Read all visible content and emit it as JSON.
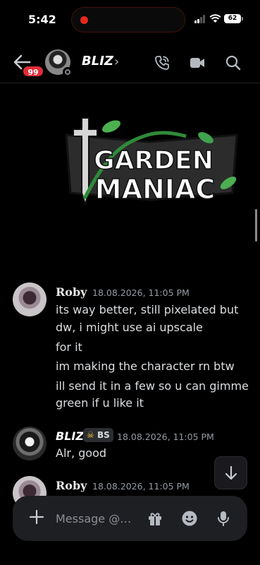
{
  "status_bar": {
    "time": "5:42",
    "battery": "62"
  },
  "header": {
    "badge_count": "99",
    "title": "BLIZ"
  },
  "banner": {
    "logo_line1": "GARDEN",
    "logo_line2": "MANIAC"
  },
  "messages": [
    {
      "author": "Roby",
      "timestamp": "18.08.2026, 11:05 PM",
      "lines": [
        "its way better, still pixelated but",
        "dw, i might use ai upscale",
        "for it",
        "im making the character rn btw",
        "ill send it in a few so u can gimme",
        "green if u like it"
      ]
    },
    {
      "author": "BLIZ",
      "tag": "BS",
      "timestamp": "18.08.2026, 11:05 PM",
      "lines": [
        "Alr, good"
      ]
    },
    {
      "author": "Roby",
      "timestamp": "18.08.2026, 11:05 PM",
      "lines": []
    }
  ],
  "composer": {
    "placeholder": "Message @…"
  },
  "colors": {
    "background": "#000000",
    "badge": "#e12d39",
    "logo_green": "#3fa34d",
    "text": "#dbdee1",
    "muted": "#949ba4"
  },
  "icons": [
    "back-arrow-icon",
    "phone-icon",
    "video-icon",
    "search-icon",
    "chevron-right-icon",
    "plus-icon",
    "gift-icon",
    "emoji-icon",
    "microphone-icon",
    "arrow-down-icon"
  ]
}
